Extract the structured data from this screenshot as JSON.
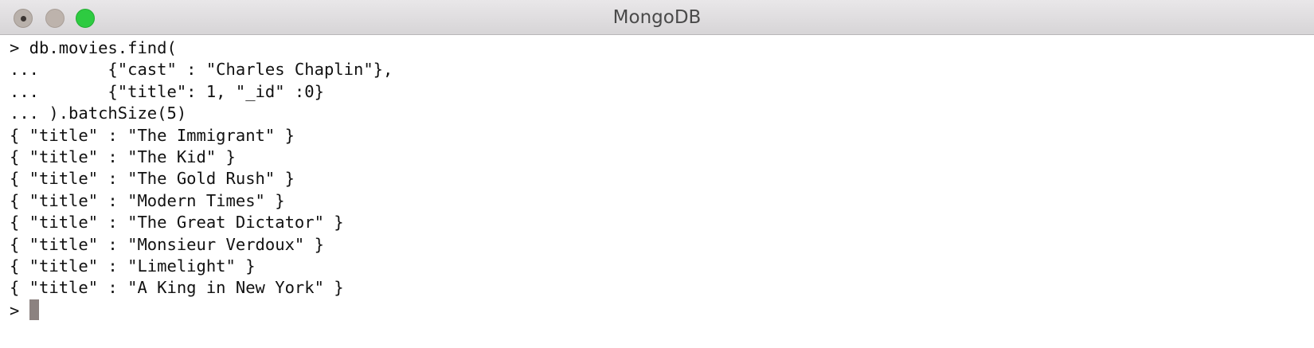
{
  "window": {
    "title": "MongoDB",
    "controls": {
      "close_icon": "close-icon",
      "minimize_icon": "minimize-icon",
      "zoom_icon": "zoom-icon",
      "close_color": "#b9b1ab",
      "minimize_color": "#bdb3ac",
      "zoom_color": "#2ecb41"
    }
  },
  "terminal": {
    "lines": [
      "> db.movies.find(",
      "...       {\"cast\" : \"Charles Chaplin\"},",
      "...       {\"title\": 1, \"_id\" :0}",
      "... ).batchSize(5)",
      "{ \"title\" : \"The Immigrant\" }",
      "{ \"title\" : \"The Kid\" }",
      "{ \"title\" : \"The Gold Rush\" }",
      "{ \"title\" : \"Modern Times\" }",
      "{ \"title\" : \"The Great Dictator\" }",
      "{ \"title\" : \"Monsieur Verdoux\" }",
      "{ \"title\" : \"Limelight\" }",
      "{ \"title\" : \"A King in New York\" }"
    ],
    "prompt": "> "
  }
}
